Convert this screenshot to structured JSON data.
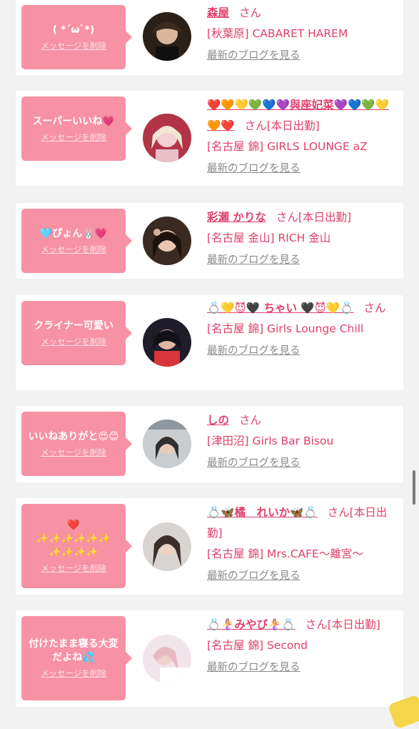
{
  "cards": [
    {
      "message": "( *´ω`*)",
      "delete": "メッセージを削除",
      "name": "森屋",
      "san": "さん",
      "status": "",
      "shop": "[秋葉原] CABARET HAREM",
      "blog": "最新のブログを見る"
    },
    {
      "message": "スーパーいいね💗",
      "delete": "メッセージを削除",
      "name": "❤️🧡💛💚💙💜與座妃菜💜💙💚💛🧡❤️",
      "san": "さん",
      "status": "[本日出勤]",
      "shop": "[名古屋 錦] GIRLS LOUNGE aZ",
      "blog": "最新のブログを見る"
    },
    {
      "message": "🩵ぴょん🐰💗",
      "delete": "メッセージを削除",
      "name": "彩瀬 かりな",
      "san": "さん",
      "status": "[本日出勤]",
      "shop": "[名古屋 金山] RICH 金山",
      "blog": "最新のブログを見る"
    },
    {
      "message": "クライナー可愛い",
      "delete": "メッセージを削除",
      "name": "💍💛😈🖤 ちゃい 🖤😈💛💍",
      "san": "さん",
      "status": "",
      "shop": "[名古屋 錦] Girls Lounge Chill",
      "blog": "最新のブログを見る"
    },
    {
      "message": "いいねありがと😍😊",
      "delete": "メッセージを削除",
      "name": "しの",
      "san": "さん",
      "status": "",
      "shop": "[津田沼] Girls Bar Bisou",
      "blog": "最新のブログを見る"
    },
    {
      "message": "❤️\n✨✨✨✨✨✨\n✨✨✨✨",
      "delete": "メッセージを削除",
      "name": "💍🦋橘　れいか🦋💍",
      "san": "さん",
      "status": "[本日出勤]",
      "shop": "[名古屋 錦] Mrs.CAFE〜離宮〜",
      "blog": "最新のブログを見る"
    },
    {
      "message": "付けたまま寝る大変だよね💦",
      "delete": "メッセージを削除",
      "name": "💍🧜‍♀️みやび🧜‍♀️💍",
      "san": "さん",
      "status": "[本日出勤]",
      "shop": "[名古屋 錦] Second",
      "blog": "最新のブログを見る"
    }
  ],
  "avatars": [
    {
      "bg": "#2a2018",
      "fg": "#d9b79a"
    },
    {
      "bg": "#b23446",
      "fg": "#f2d0d5"
    },
    {
      "bg": "#3a2a22",
      "fg": "#e8c6b4"
    },
    {
      "bg": "#1f1d2a",
      "fg": "#e0b6a4"
    },
    {
      "bg": "#c9cdd0",
      "fg": "#2f2f2f"
    },
    {
      "bg": "#d8d4d2",
      "fg": "#3a2e2a"
    },
    {
      "bg": "#f1e4ea",
      "fg": "#e8b8c2"
    }
  ],
  "colors": {
    "accent": "#e0406c",
    "bubble": "#f791a4",
    "blog": "#8a8a8a"
  }
}
